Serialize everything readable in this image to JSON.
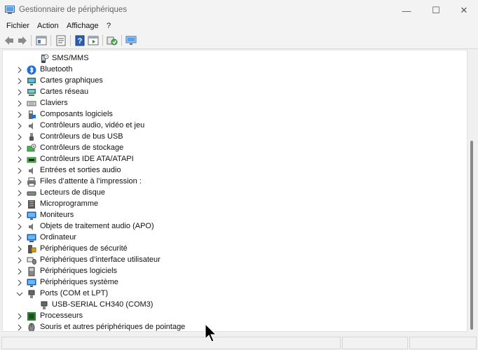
{
  "window": {
    "title": "Gestionnaire de périphériques"
  },
  "window_controls": {
    "minimize": "—",
    "maximize": "☐",
    "close": "✕"
  },
  "menu": [
    "Fichier",
    "Action",
    "Affichage",
    "?"
  ],
  "tree": {
    "top_child": {
      "label": "SMS/MMS",
      "icon": "sms-device-icon"
    },
    "items": [
      {
        "label": "Bluetooth",
        "icon": "bluetooth-icon",
        "expanded": false
      },
      {
        "label": "Cartes graphiques",
        "icon": "display-adapter-icon",
        "expanded": false
      },
      {
        "label": "Cartes réseau",
        "icon": "network-adapter-icon",
        "expanded": false
      },
      {
        "label": "Claviers",
        "icon": "keyboard-icon",
        "expanded": false
      },
      {
        "label": "Composants logiciels",
        "icon": "software-component-icon",
        "expanded": false
      },
      {
        "label": "Contrôleurs audio, vidéo et jeu",
        "icon": "speaker-icon",
        "expanded": false
      },
      {
        "label": "Contrôleurs de bus USB",
        "icon": "usb-icon",
        "expanded": false
      },
      {
        "label": "Contrôleurs de stockage",
        "icon": "storage-controller-icon",
        "expanded": false
      },
      {
        "label": "Contrôleurs IDE ATA/ATAPI",
        "icon": "ide-controller-icon",
        "expanded": false
      },
      {
        "label": "Entrées et sorties audio",
        "icon": "speaker-icon",
        "expanded": false
      },
      {
        "label": "Files d’attente à l’impression :",
        "icon": "printer-icon",
        "expanded": false
      },
      {
        "label": "Lecteurs de disque",
        "icon": "disk-drive-icon",
        "expanded": false
      },
      {
        "label": "Microprogramme",
        "icon": "firmware-icon",
        "expanded": false
      },
      {
        "label": "Moniteurs",
        "icon": "monitor-icon",
        "expanded": false
      },
      {
        "label": "Objets de traitement audio (APO)",
        "icon": "speaker-icon",
        "expanded": false
      },
      {
        "label": "Ordinateur",
        "icon": "computer-icon",
        "expanded": false
      },
      {
        "label": "Périphériques de sécurité",
        "icon": "security-device-icon",
        "expanded": false
      },
      {
        "label": "Périphériques d’interface utilisateur",
        "icon": "hid-icon",
        "expanded": false
      },
      {
        "label": "Périphériques logiciels",
        "icon": "software-device-icon",
        "expanded": false
      },
      {
        "label": "Périphériques système",
        "icon": "system-device-icon",
        "expanded": false
      },
      {
        "label": "Ports (COM et LPT)",
        "icon": "port-icon",
        "expanded": true
      },
      {
        "label": "USB-SERIAL CH340 (COM3)",
        "icon": "port-icon",
        "child": true
      },
      {
        "label": "Processeurs",
        "icon": "processor-icon",
        "expanded": false
      },
      {
        "label": "Souris et autres périphériques de pointage",
        "icon": "mouse-icon",
        "expanded": false
      }
    ]
  },
  "colors": {
    "window_bg": "#f0f0f0",
    "content_bg": "#ffffff",
    "accent_blue": "#1e6fd9"
  }
}
